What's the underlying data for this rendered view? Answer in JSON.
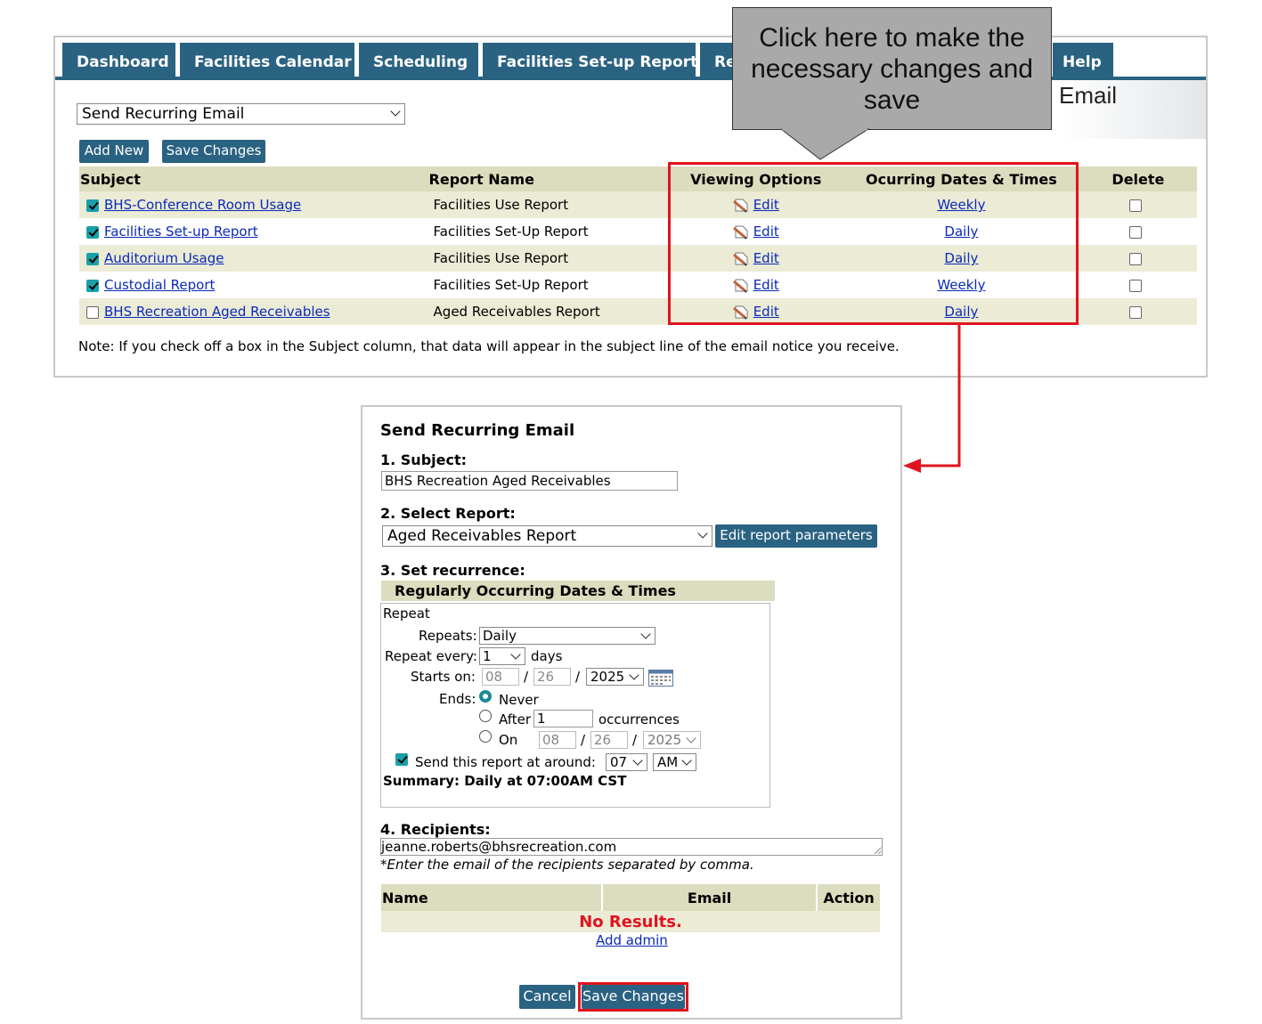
{
  "nav": {
    "tabs": [
      "Dashboard",
      "Facilities Calendar",
      "Scheduling",
      "Facilities Set-up Report",
      "Re"
    ],
    "help": "Help"
  },
  "header": {
    "page_title_partial": "Email"
  },
  "toolbar": {
    "view_select": "Send Recurring Email",
    "add_new": "Add New",
    "save_changes": "Save Changes"
  },
  "grid": {
    "headers": [
      "Subject",
      "Report Name",
      "Viewing Options",
      "Ocurring Dates & Times",
      "Delete"
    ],
    "rows": [
      {
        "subject": "BHS-Conference Room Usage",
        "checked": true,
        "report": "Facilities Use Report",
        "view": "Edit",
        "occurs": "Weekly"
      },
      {
        "subject": "Facilities Set-up Report",
        "checked": true,
        "report": "Facilities Set-Up Report",
        "view": "Edit",
        "occurs": "Daily"
      },
      {
        "subject": "Auditorium Usage",
        "checked": true,
        "report": "Facilities Use Report",
        "view": "Edit",
        "occurs": "Daily"
      },
      {
        "subject": "Custodial Report",
        "checked": true,
        "report": "Facilities Set-Up Report",
        "view": "Edit",
        "occurs": "Weekly"
      },
      {
        "subject": "BHS Recreation Aged Receivables",
        "checked": false,
        "report": "Aged Receivables Report",
        "view": "Edit",
        "occurs": "Daily"
      }
    ]
  },
  "note": "Note: If you check off a box in the Subject column, that data will appear in the subject line of the email notice you receive.",
  "callout": {
    "text": "Click here to make the necessary changes and save"
  },
  "form": {
    "title": "Send Recurring Email",
    "subject_label": "1. Subject:",
    "subject_value": "BHS Recreation Aged Receivables",
    "report_label": "2. Select Report:",
    "report_value": "Aged Receivables Report",
    "edit_params": "Edit report parameters",
    "recurrence_label": "3. Set recurrence:",
    "recurrence_header": "Regularly Occurring Dates & Times",
    "repeat_title": "Repeat",
    "repeats_label": "Repeats:",
    "repeats_value": "Daily",
    "repeat_every_label": "Repeat every:",
    "repeat_every_value": "1",
    "repeat_every_unit": "days",
    "starts_label": "Starts on:",
    "starts_month": "08",
    "starts_day": "26",
    "starts_year": "2025",
    "slash": "/",
    "ends_label": "Ends:",
    "ends_never": "Never",
    "ends_after": "After",
    "after_value": "1",
    "occurrences": "occurrences",
    "ends_on": "On",
    "on_month": "08",
    "on_day": "26",
    "on_year": "2025",
    "send_around_label": "Send this report at around:",
    "send_hour": "07",
    "send_ampm": "AM",
    "summary": "Summary: Daily at 07:00AM CST",
    "recipients_label": "4. Recipients:",
    "recipients_value": "jeanne.roberts@bhsrecreation.com",
    "recipients_hint": "*Enter the email of the recipients separated by comma.",
    "rec_headers": [
      "Name",
      "Email",
      "Action"
    ],
    "no_results": "No Results.",
    "add_admin": "Add admin",
    "cancel": "Cancel",
    "save": "Save Changes"
  },
  "colors": {
    "nav": "#2a6282",
    "highlight": "#e0141e",
    "header_row": "#dcdcbe",
    "stripe": "#ebebd6",
    "link": "#0a2ab8"
  }
}
